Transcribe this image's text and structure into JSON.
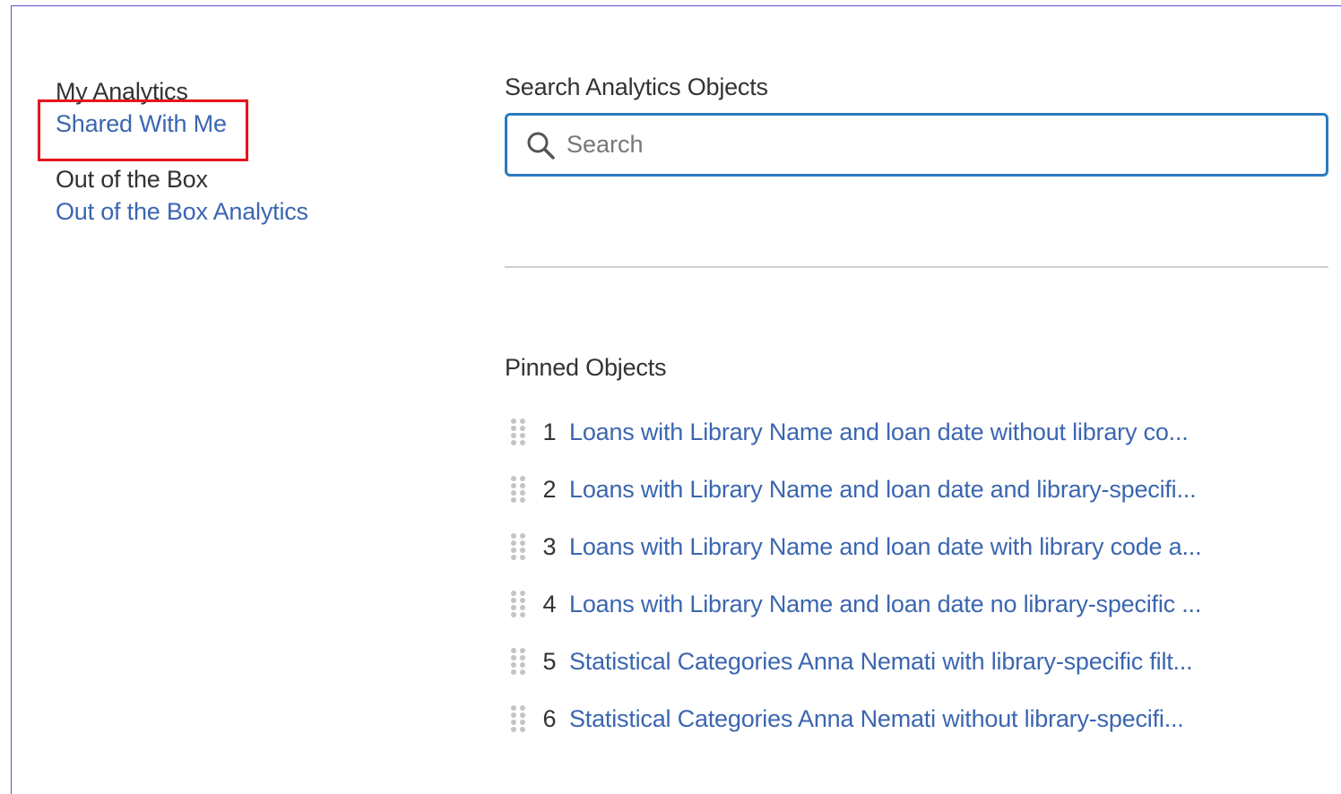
{
  "nav": {
    "my_analytics_heading": "My Analytics",
    "shared_with_me_link": "Shared With Me",
    "out_of_box_heading": "Out of the Box",
    "out_of_box_link": "Out of the Box Analytics"
  },
  "search": {
    "title": "Search Analytics Objects",
    "placeholder": "Search"
  },
  "pinned": {
    "title": "Pinned Objects",
    "items": [
      {
        "num": "1",
        "label": "Loans with Library Name and loan date without library co..."
      },
      {
        "num": "2",
        "label": "Loans with Library Name and loan date and library-specifi..."
      },
      {
        "num": "3",
        "label": "Loans with Library Name and loan date with library code a..."
      },
      {
        "num": "4",
        "label": "Loans with Library Name and loan date no library-specific ..."
      },
      {
        "num": "5",
        "label": "Statistical Categories Anna Nemati with library-specific filt..."
      },
      {
        "num": "6",
        "label": "Statistical Categories Anna Nemati without library-specifi..."
      }
    ]
  },
  "colors": {
    "link": "#3b66b0",
    "search_border": "#2a7bbf",
    "highlight": "#e8141b",
    "frame": "#6a4fc9"
  }
}
